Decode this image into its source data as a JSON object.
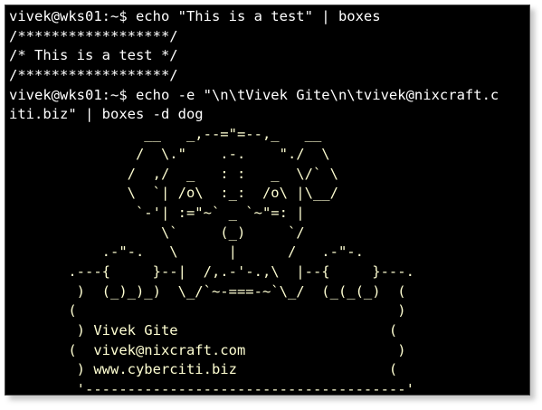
{
  "terminal": {
    "background": "#000000",
    "foreground": "#ffffff",
    "art_color": "#ffffd2",
    "lines": [
      {
        "text": "vivek@wks01:~$ echo \"This is a test\" | boxes",
        "kind": "prompt"
      },
      {
        "text": "/******************/",
        "kind": "comment"
      },
      {
        "text": "/* This is a test */",
        "kind": "comment"
      },
      {
        "text": "/******************/",
        "kind": "comment"
      },
      {
        "text": "vivek@wks01:~$ echo -e \"\\n\\tVivek Gite\\n\\tvivek@nixcraft.c",
        "kind": "prompt"
      },
      {
        "text": "iti.biz\" | boxes -d dog",
        "kind": "prompt"
      },
      {
        "text": "                __   _,--=\"=--,_   __",
        "kind": "art"
      },
      {
        "text": "               /  \\.\"    .-.    \"./  \\",
        "kind": "art"
      },
      {
        "text": "              /  ,/  _   : :   _  \\/` \\",
        "kind": "art"
      },
      {
        "text": "              \\  `| /o\\  :_:  /o\\ |\\__/",
        "kind": "art"
      },
      {
        "text": "               `-'| :=\"~` _ `~\"=: |",
        "kind": "art"
      },
      {
        "text": "                  \\`     (_)     `/",
        "kind": "art"
      },
      {
        "text": "           .-\"-.   \\      |      /   .-\"-.",
        "kind": "art"
      },
      {
        "text": "       .---{     }--|  /,.-'-.,\\  |--{     }---.",
        "kind": "art"
      },
      {
        "text": "        )  (_)_)_)  \\_/`~-===-~`\\_/  (_(_(_)  (",
        "kind": "art"
      },
      {
        "text": "       (                                      )",
        "kind": "art"
      },
      {
        "text": "        ) Vivek Gite                         (",
        "kind": "art"
      },
      {
        "text": "       (  vivek@nixcraft.com                  )",
        "kind": "art"
      },
      {
        "text": "        ) www.cyberciti.biz                  (",
        "kind": "art"
      },
      {
        "text": "        '--------------------------------------'",
        "kind": "art"
      }
    ]
  }
}
